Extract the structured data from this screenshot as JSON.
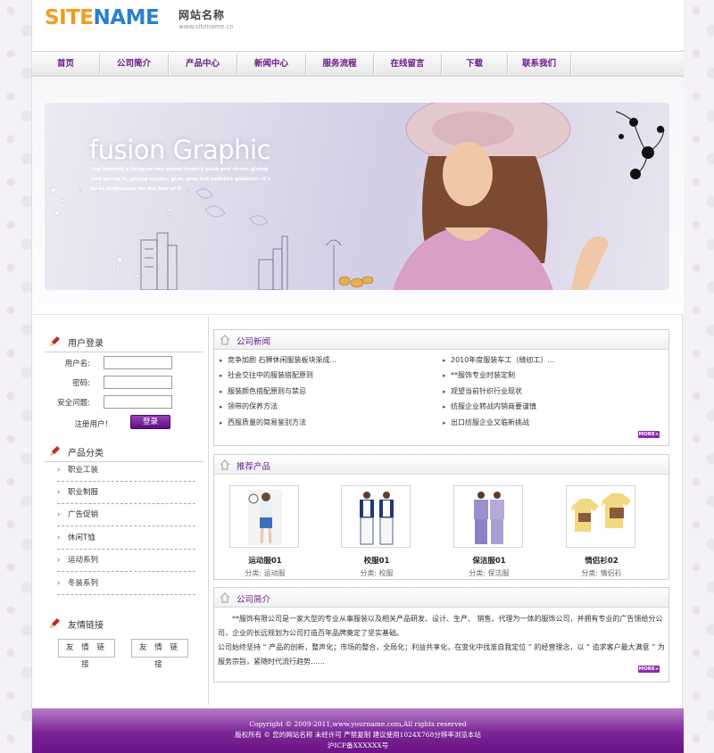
{
  "logo": {
    "part1": "SITE",
    "part2": "NAME",
    "cn": "网站名称",
    "url": "www.sitename.cn"
  },
  "nav": [
    "首页",
    "公司简介",
    "产品中心",
    "新闻中心",
    "服务流程",
    "在线留言",
    "下载",
    "联系我们"
  ],
  "banner": {
    "title": "fusion Graphic",
    "subtitle": "i've learned a thing or two about lovelt's push and shove giving and giving in, giving sugins, give, give but nuthin's givensin- it's been brokenjust for the bell of it"
  },
  "login": {
    "title": "用户登录",
    "username_label": "用户名:",
    "password_label": "密码:",
    "security_label": "安全问题:",
    "register_label": "注册用户！",
    "login_button": "登录"
  },
  "categories": {
    "title": "产品分类",
    "items": [
      "职业工装",
      "职业制服",
      "广告促销",
      "休闲T恤",
      "运动系列",
      "冬装系列"
    ]
  },
  "friend_links": {
    "title": "友情链接",
    "buttons": [
      "友 情 链 接",
      "友 情 链 接"
    ]
  },
  "news": {
    "title": "公司新闻",
    "left": [
      "竞争加剧 石狮休闲服装板块渐成...",
      "社会交往中的服装搭配原则",
      "服装颜色搭配原则与禁忌",
      "领带的保养方法",
      "西服质量的简易鉴别方法"
    ],
    "right": [
      "2010年度服装车工（缝纫工）...",
      "**服饰专业时装定制",
      "观望当前针织行业现状",
      "纺服企业转战内销商要谨慎",
      "出口纺服企业又临新挑战"
    ],
    "more": "MORE+"
  },
  "products": {
    "title": "推荐产品",
    "items": [
      {
        "name": "运动服01",
        "category": "分类: 运动服"
      },
      {
        "name": "校服01",
        "category": "分类: 校服"
      },
      {
        "name": "保洁服01",
        "category": "分类: 保洁服"
      },
      {
        "name": "情侣衫02",
        "category": "分类: 情侣衫"
      }
    ]
  },
  "about": {
    "title": "公司简介",
    "para1": "**服饰有限公司是一家大型的专业从事服装以及相关产品研发、设计、生产、 销售、代理为一体的服饰公司，并拥有专业的广告馈给分公司，企业的长远规划为公司打造百年品牌奠定了坚实基础。",
    "para2": "公司始终坚持 “ 产品的创新，整声化；市场的整合，全局化；利益共享化，在变化中找准自我定位 ” 的经营理念，以 “ 追求客户最大满意 ” 为服务宗旨，紧随时代流行趋势……",
    "more": "MORE+"
  },
  "footer": {
    "line1": "Copyright © 2009-2011,www.yourname.com,All rights reserved",
    "line2": "版权所有 © 您的网站名称 未经许可 严禁复制 建议使用1024X768分辨率浏览本站",
    "line3": "沪ICP备XXXXXX号"
  },
  "colors": {
    "accent": "#6a1b8a",
    "footer": "#7a2596",
    "logo_orange": "#f29b1d",
    "logo_blue": "#2a7fcf"
  }
}
